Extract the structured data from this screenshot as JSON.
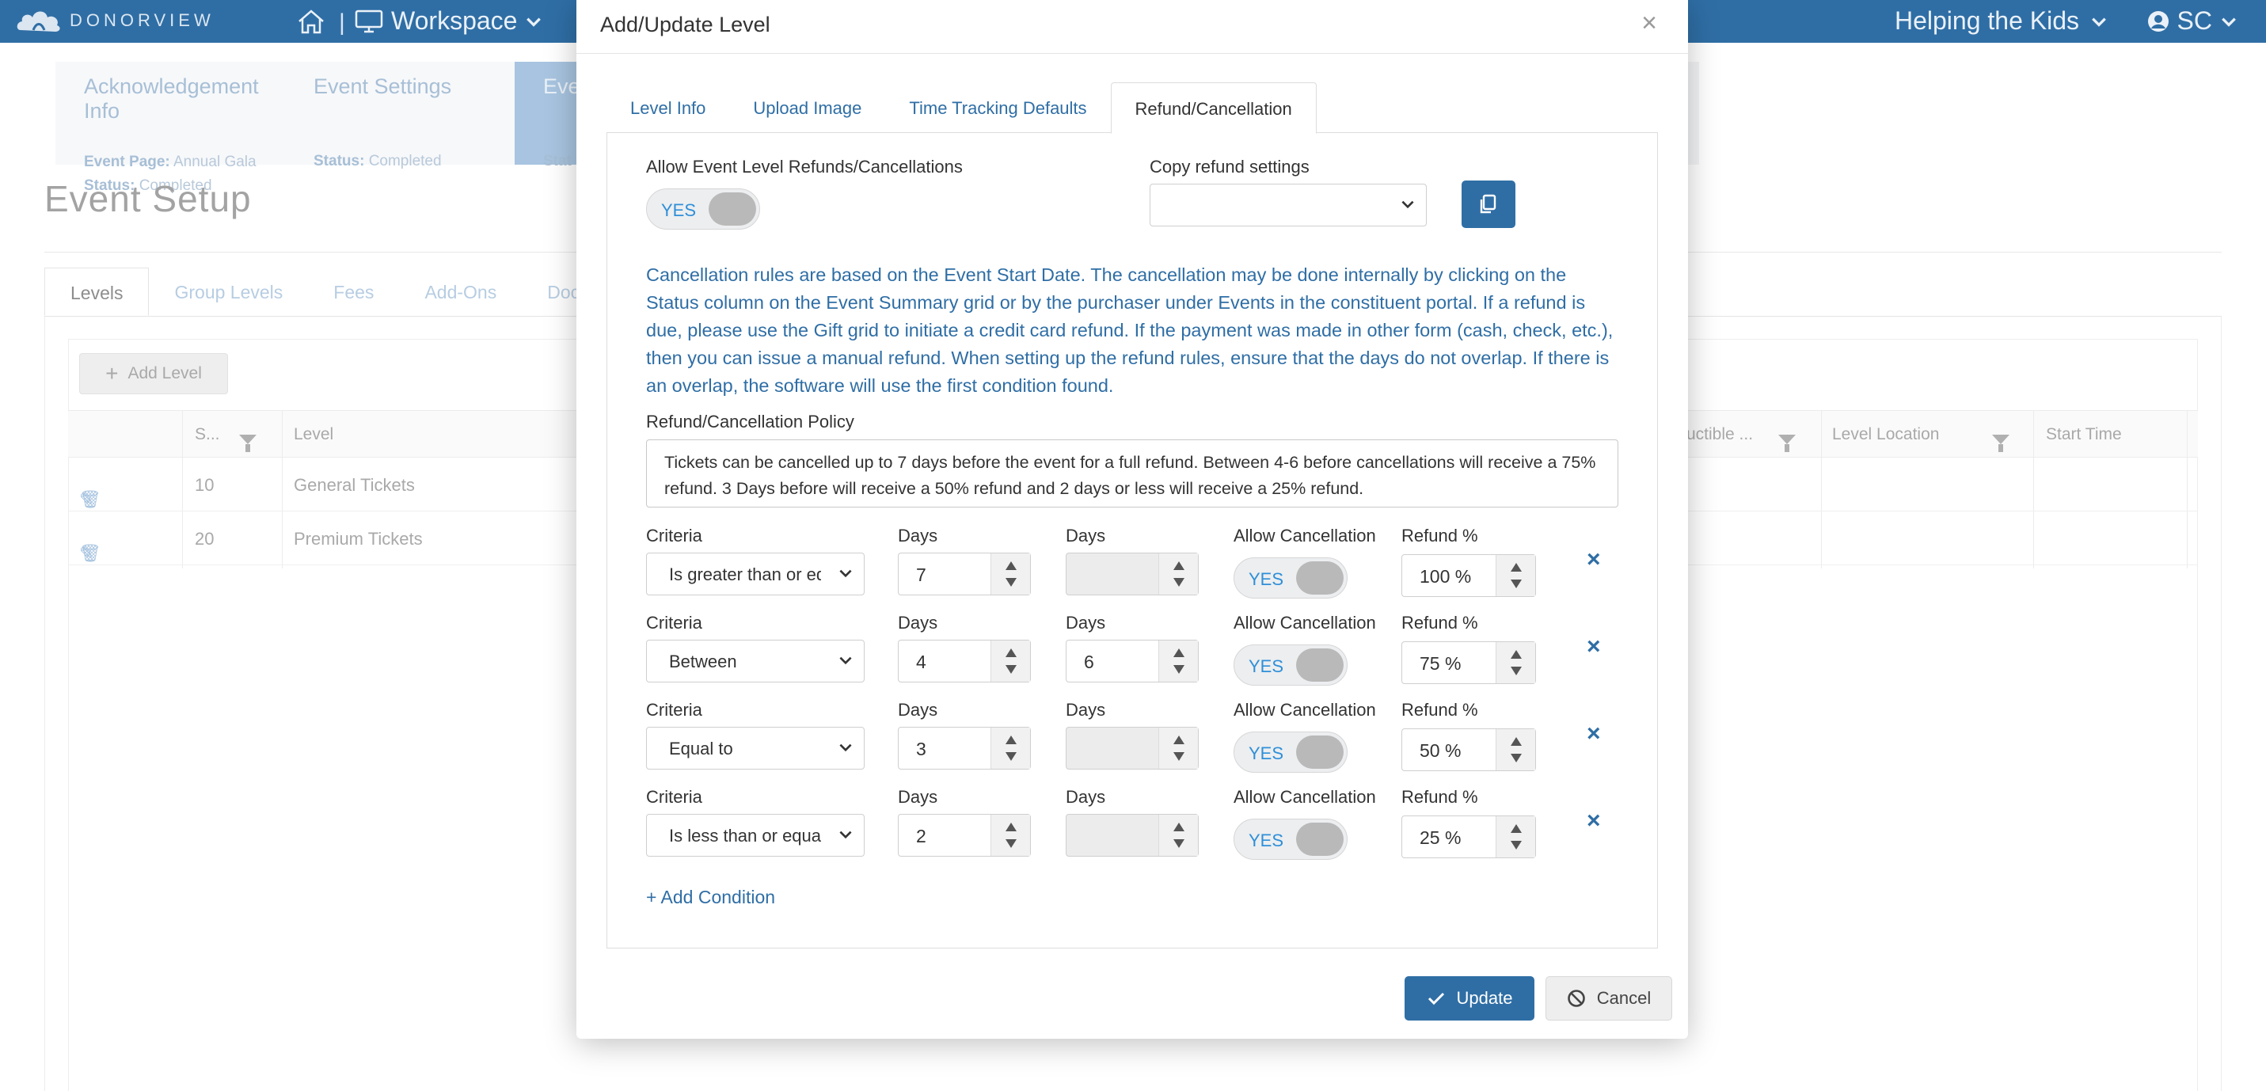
{
  "topbar": {
    "logo_text": "DONORVIEW",
    "workspace_label": "Workspace",
    "org_name": "Helping the Kids",
    "user_initials": "SC"
  },
  "wizard": {
    "steps": [
      {
        "title": "Acknowledgement Info",
        "line1_label": "Event Page:",
        "line1_value": "Annual Gala",
        "status_label": "Status:",
        "status_value": "Completed"
      },
      {
        "title": "Event Settings",
        "status_label": "Status:",
        "status_value": "Completed"
      },
      {
        "title": "Eve",
        "status_label": "Stat"
      }
    ]
  },
  "page": {
    "title": "Event Setup",
    "tabs": [
      "Levels",
      "Group Levels",
      "Fees",
      "Add-Ons",
      "Docum"
    ],
    "add_level_label": "Add Level",
    "grid": {
      "columns": [
        "S...",
        "Level",
        "uctible ...",
        "Level Location",
        "Start Time"
      ],
      "rows": [
        {
          "seq": "10",
          "level": "General Tickets"
        },
        {
          "seq": "20",
          "level": "Premium Tickets"
        }
      ]
    }
  },
  "modal": {
    "title": "Add/Update Level",
    "tabs": [
      "Level Info",
      "Upload Image",
      "Time Tracking Defaults",
      "Refund/Cancellation"
    ],
    "allow_refunds_label": "Allow Event Level Refunds/Cancellations",
    "allow_refunds_value": "YES",
    "copy_settings_label": "Copy refund settings",
    "copy_settings_value": "",
    "info_text": "Cancellation rules are based on the Event Start Date. The cancellation may be done internally by clicking on the Status column on the Event Summary grid or by the purchaser under Events in the constituent portal. If a refund is due, please use the Gift grid to initiate a credit card refund. If the payment was made in other form (cash, check, etc.), then you can issue a manual refund. When setting up the refund rules, ensure that the days do not overlap. If there is an overlap, the software will use the first condition found.",
    "policy_label": "Refund/Cancellation Policy",
    "policy_text": "Tickets can be cancelled up to 7 days before the event for a full refund. Between 4-6 before cancellations will receive a 75% refund. 3 Days before will receive a 50% refund and 2 days or less will receive a 25% refund.",
    "condition_labels": {
      "criteria": "Criteria",
      "days1": "Days",
      "days2": "Days",
      "allow": "Allow Cancellation",
      "refund": "Refund %"
    },
    "conditions": [
      {
        "criteria": "Is greater than or equal to",
        "days1": "7",
        "days2": "",
        "allow": "YES",
        "refund": "100 %"
      },
      {
        "criteria": "Between",
        "days1": "4",
        "days2": "6",
        "allow": "YES",
        "refund": "75 %"
      },
      {
        "criteria": "Equal to",
        "days1": "3",
        "days2": "",
        "allow": "YES",
        "refund": "50 %"
      },
      {
        "criteria": "Is less than or equal to",
        "days1": "2",
        "days2": "",
        "allow": "YES",
        "refund": "25 %"
      }
    ],
    "add_condition_label": "+ Add Condition",
    "update_label": "Update",
    "cancel_label": "Cancel"
  },
  "colors": {
    "brand": "#2f6ea5",
    "toggle_text": "#2f8fd8"
  }
}
